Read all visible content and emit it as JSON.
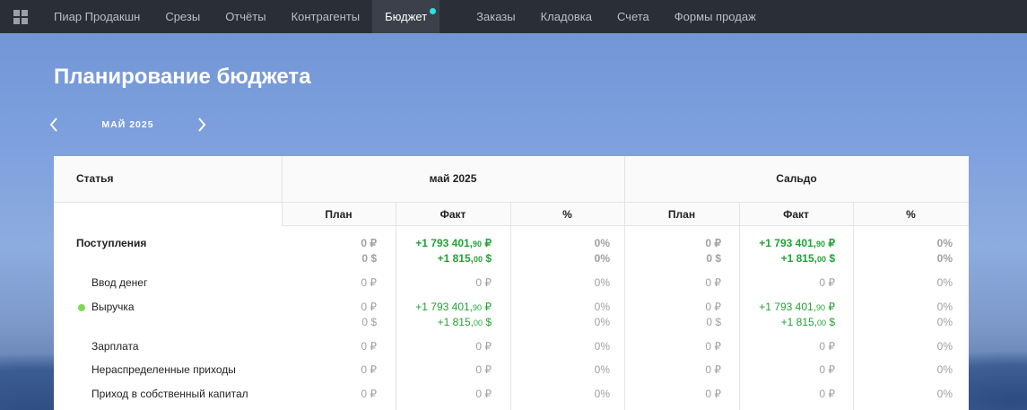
{
  "nav": {
    "items": [
      {
        "label": "Пиар Продакшн"
      },
      {
        "label": "Срезы"
      },
      {
        "label": "Отчёты"
      },
      {
        "label": "Контрагенты"
      },
      {
        "label": "Бюджет",
        "active": true
      },
      {
        "label": "Заказы"
      },
      {
        "label": "Кладовка"
      },
      {
        "label": "Счета"
      },
      {
        "label": "Формы продаж"
      }
    ]
  },
  "page": {
    "title": "Планирование бюджета",
    "period": "МАЙ 2025"
  },
  "table": {
    "headers": {
      "article": "Статья",
      "month": "май 2025",
      "saldo": "Сальдо",
      "plan": "План",
      "fact": "Факт",
      "pct": "%"
    },
    "rows": [
      {
        "label": "Поступления",
        "plan_rub": "0 ₽",
        "plan_usd": "0 $",
        "fact_rub_int": "+1 793 401,",
        "fact_rub_dec": "90",
        "fact_rub_cur": " ₽",
        "fact_usd_int": "+1 815,",
        "fact_usd_dec": "00",
        "fact_usd_cur": " $",
        "pct1": "0%",
        "pct2": "0%",
        "saldo_plan_rub": "0 ₽",
        "saldo_plan_usd": "0 $",
        "saldo_fact_rub_int": "+1 793 401,",
        "saldo_fact_rub_dec": "90",
        "saldo_fact_rub_cur": " ₽",
        "saldo_fact_usd_int": "+1 815,",
        "saldo_fact_usd_dec": "00",
        "saldo_fact_usd_cur": " $",
        "saldo_pct1": "0%",
        "saldo_pct2": "0%"
      },
      {
        "label": "Ввод денег",
        "plan": "0 ₽",
        "fact": "0 ₽",
        "pct": "0%",
        "saldo_plan": "0 ₽",
        "saldo_fact": "0 ₽",
        "saldo_pct": "0%"
      },
      {
        "label": "Выручка",
        "plan_rub": "0 ₽",
        "plan_usd": "0 $",
        "fact_rub_int": "+1 793 401,",
        "fact_rub_dec": "90",
        "fact_rub_cur": " ₽",
        "fact_usd_int": "+1 815,",
        "fact_usd_dec": "00",
        "fact_usd_cur": " $",
        "pct1": "0%",
        "pct2": "0%",
        "saldo_plan_rub": "0 ₽",
        "saldo_plan_usd": "0 $",
        "saldo_fact_rub_int": "+1 793 401,",
        "saldo_fact_rub_dec": "90",
        "saldo_fact_rub_cur": " ₽",
        "saldo_fact_usd_int": "+1 815,",
        "saldo_fact_usd_dec": "00",
        "saldo_fact_usd_cur": " $",
        "saldo_pct1": "0%",
        "saldo_pct2": "0%",
        "dot_color": "#7ed957"
      },
      {
        "label": "Зарплата",
        "plan": "0 ₽",
        "fact": "0 ₽",
        "pct": "0%",
        "saldo_plan": "0 ₽",
        "saldo_fact": "0 ₽",
        "saldo_pct": "0%"
      },
      {
        "label": "Нераспределенные приходы",
        "plan": "0 ₽",
        "fact": "0 ₽",
        "pct": "0%",
        "saldo_plan": "0 ₽",
        "saldo_fact": "0 ₽",
        "saldo_pct": "0%"
      },
      {
        "label": "Приход в собственный капитал",
        "plan": "0 ₽",
        "fact": "0 ₽",
        "pct": "0%",
        "saldo_plan": "0 ₽",
        "saldo_fact": "0 ₽",
        "saldo_pct": "0%"
      }
    ]
  },
  "colors": {
    "nav_bg": "#2a2e36",
    "active_dot": "#2fe0e8",
    "positive": "#21a336",
    "muted": "#a0a0a0"
  },
  "icons": {
    "apps": "grid-icon",
    "prev": "chevron-left-icon",
    "next": "chevron-right-icon"
  }
}
